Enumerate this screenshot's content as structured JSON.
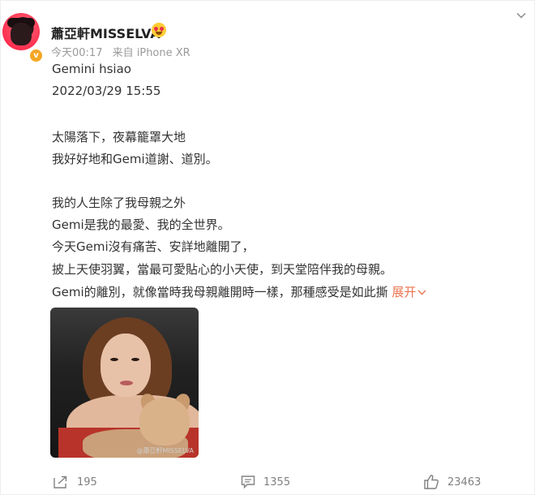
{
  "post": {
    "username": "蕭亞軒MISSELVA",
    "verified_badge": "v",
    "time": "今天00:17",
    "source": "来自 iPhone XR",
    "lines": [
      "Gemini hsiao",
      "2022/03/29 15:55",
      "太陽落下，夜幕籠罩大地",
      "我好好地和Gemi道謝、道別。",
      "我的人生除了我母親之外",
      "Gemi是我的最愛、我的全世界。",
      "今天Gemi沒有痛苦、安詳地離開了，",
      "披上天使羽翼，當最可愛貼心的小天使，到天堂陪伴我的母親。",
      "Gemi的離別，就像當時我母親離開時一樣，那種感受是如此撕"
    ],
    "expand_label": "展开",
    "photo_watermark": "@蕭亞軒MISSELVA"
  },
  "actions": {
    "share_count": "195",
    "comment_count": "1355",
    "like_count": "23463"
  },
  "colors": {
    "accent": "#eb7350",
    "meta_gray": "#9a9a9a",
    "text": "#333333"
  },
  "icons": [
    "chevron-down-icon",
    "emoji-icon",
    "share-icon",
    "comment-icon",
    "like-icon"
  ]
}
